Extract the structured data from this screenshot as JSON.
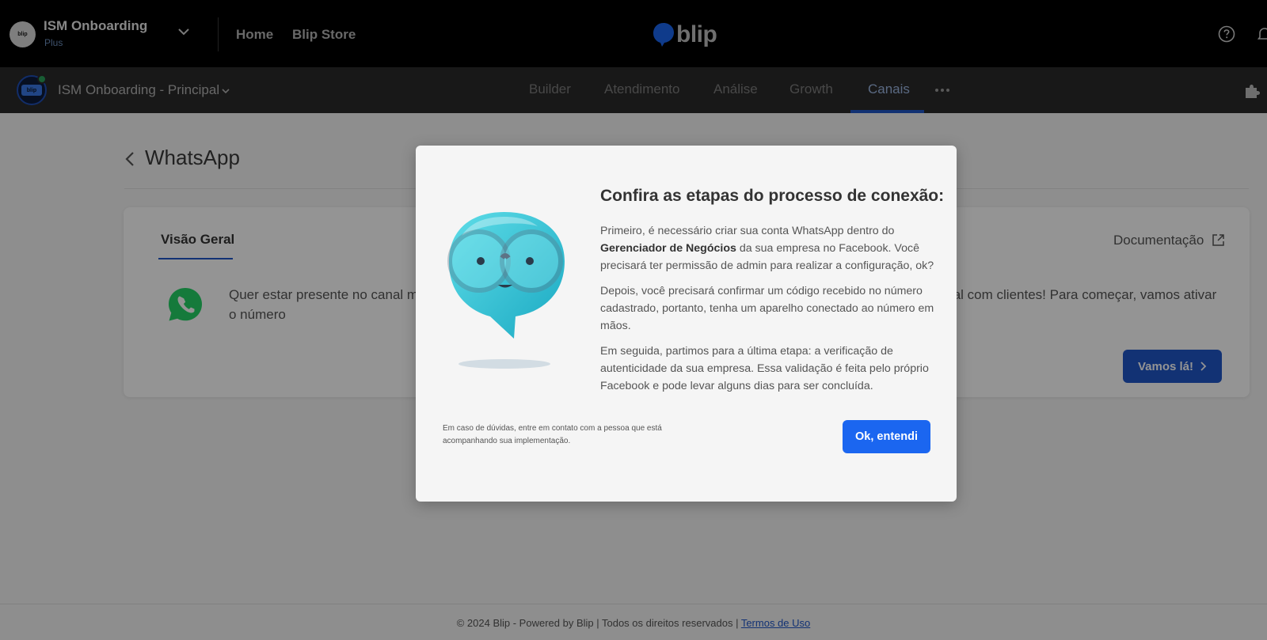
{
  "topbar": {
    "org_avatar_text": "blip",
    "org_name": "ISM Onboarding",
    "org_plan": "Plus",
    "nav_home": "Home",
    "nav_store": "Blip Store",
    "brand_text": "blip"
  },
  "subnav": {
    "bot_avatar_text": "blip",
    "bot_name": "ISM Onboarding - Principal",
    "tabs": [
      {
        "label": "Builder"
      },
      {
        "label": "Atendimento"
      },
      {
        "label": "Análise"
      },
      {
        "label": "Growth"
      },
      {
        "label": "Canais",
        "active": true
      }
    ]
  },
  "page": {
    "title": "WhatsApp",
    "tab_label": "Visão Geral",
    "doc_link": "Documentação",
    "intro_text": "Quer estar presente no canal mais usado pelos brasileiros? Conecte-se ao WhatsApp e comece a ganhar proximidade real com clientes! Para começar, vamos ativar o número",
    "cta_label": "Vamos lá!"
  },
  "modal": {
    "title": "Confira as etapas do processo de conexão:",
    "p1_before": "Primeiro, é necessário criar sua conta WhatsApp dentro do ",
    "p1_bold": "Gerenciador de Negócios",
    "p1_after": " da sua empresa no Facebook. Você precisará ter permissão de admin para realizar a configuração, ok?",
    "p2": "Depois, você precisará confirmar um código recebido no número cadastrado, portanto, tenha um aparelho conectado ao número em mãos.",
    "p3": "Em seguida, partimos para a última etapa: a verificação de autenticidade da sua empresa. Essa validação é feita pelo próprio Facebook e pode levar alguns dias para ser concluída.",
    "note": "Em caso de dúvidas, entre em contato com a pessoa que está acompanhando sua implementação.",
    "ok_label": "Ok, entendi"
  },
  "footer": {
    "text": "© 2024 Blip - Powered by Blip | Todos os direitos reservados | ",
    "link": "Termos de Uso"
  },
  "colors": {
    "primary": "#1b66f0",
    "accent_dark": "#1f56c8",
    "topbar_bg": "#000000",
    "subnav_bg": "#2a2a2a"
  }
}
